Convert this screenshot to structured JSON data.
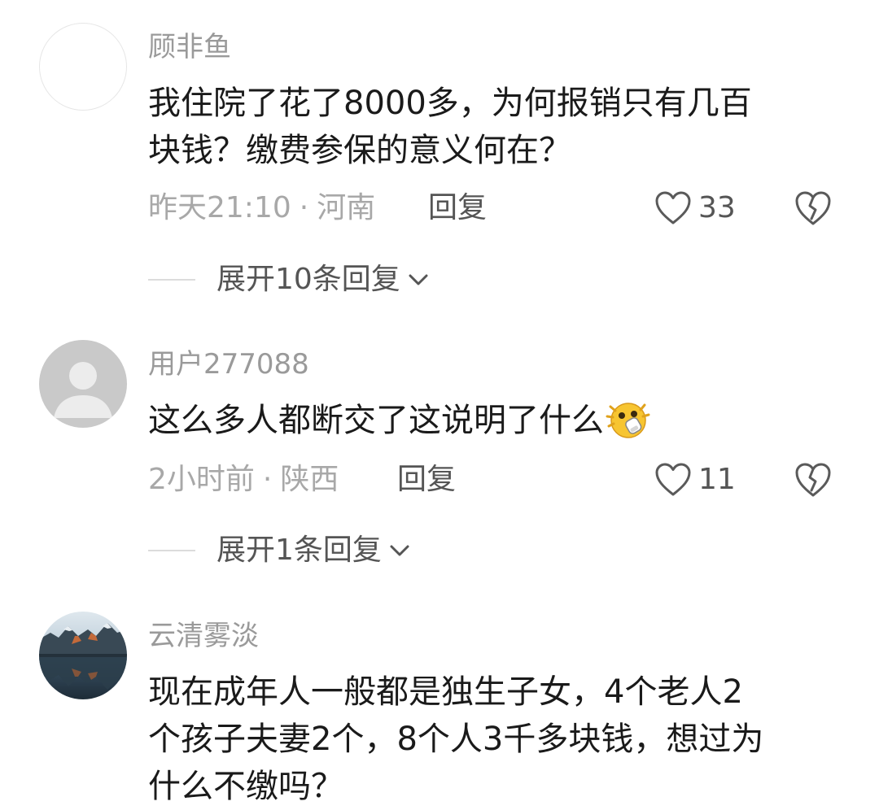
{
  "comments": [
    {
      "username": "顾非鱼",
      "content_lines": [
        "我住院了花了8000多，为何报销只有几百",
        "块钱？缴费参保的意义何在？"
      ],
      "time": "昨天21:10",
      "separator": "·",
      "location": "河南",
      "reply_label": "回复",
      "likes": "33",
      "expand_label": "展开10条回复",
      "avatar": "blank"
    },
    {
      "username": "用户277088",
      "content_lines": [
        "这么多人都断交了这说明了什么"
      ],
      "emoji": "shocked-emoji",
      "time": "2小时前",
      "separator": "·",
      "location": "陕西",
      "reply_label": "回复",
      "likes": "11",
      "expand_label": "展开1条回复",
      "avatar": "default-user"
    },
    {
      "username": "云清雾淡",
      "content_lines": [
        "现在成年人一般都是独生子女，4个老人2",
        "个孩子夫妻2个，8个人3千多块钱，想过为",
        "什么不缴吗？"
      ],
      "avatar": "mountain-lake-photo"
    }
  ],
  "colors": {
    "username": "#9a9a9a",
    "meta": "#a8a8a8",
    "action": "#555555",
    "content": "#1a1a1a"
  }
}
